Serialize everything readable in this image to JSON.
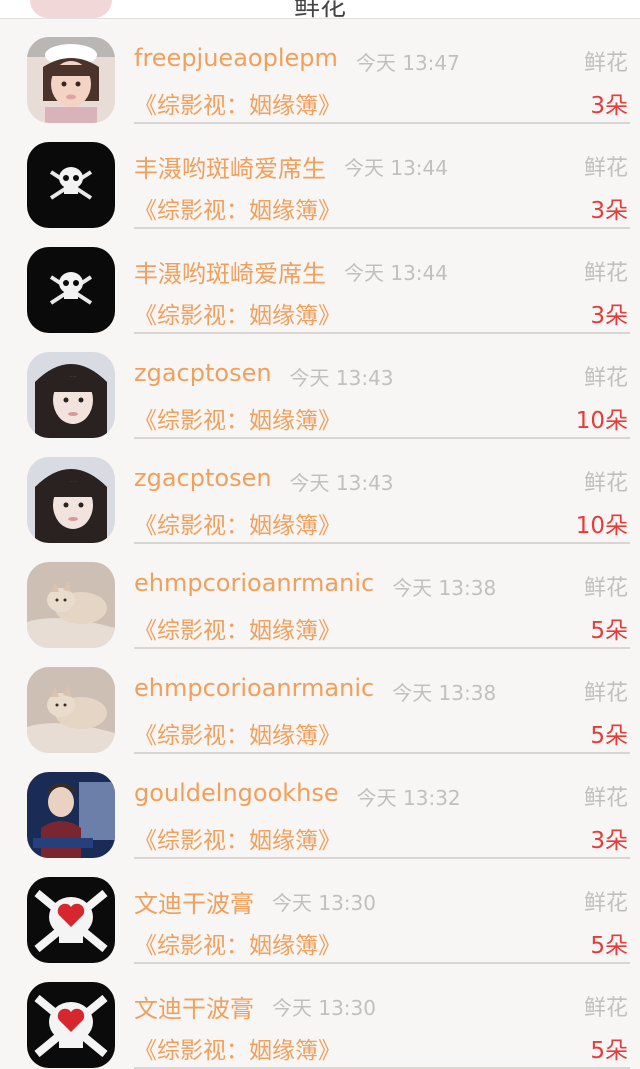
{
  "header": {
    "title": "鲜花"
  },
  "rows": [
    {
      "name": "freepjueaoplepm",
      "time": "今天 13:47",
      "gift_label": "鲜花",
      "book": "《综影视：姻缘簿》",
      "count": "3朵",
      "avatar": "girl-photo"
    },
    {
      "name": "丰滠哟斑崎爱席生",
      "time": "今天 13:44",
      "gift_label": "鲜花",
      "book": "《综影视：姻缘簿》",
      "count": "3朵",
      "avatar": "skull-emblem"
    },
    {
      "name": "丰滠哟斑崎爱席生",
      "time": "今天 13:44",
      "gift_label": "鲜花",
      "book": "《综影视：姻缘簿》",
      "count": "3朵",
      "avatar": "skull-emblem"
    },
    {
      "name": "zgacptosen",
      "time": "今天 13:43",
      "gift_label": "鲜花",
      "book": "《综影视：姻缘簿》",
      "count": "10朵",
      "avatar": "woman-photo"
    },
    {
      "name": "zgacptosen",
      "time": "今天 13:43",
      "gift_label": "鲜花",
      "book": "《综影视：姻缘簿》",
      "count": "10朵",
      "avatar": "woman-photo"
    },
    {
      "name": "ehmpcorioanrmanic",
      "time": "今天 13:38",
      "gift_label": "鲜花",
      "book": "《综影视：姻缘簿》",
      "count": "5朵",
      "avatar": "cat-photo"
    },
    {
      "name": "ehmpcorioanrmanic",
      "time": "今天 13:38",
      "gift_label": "鲜花",
      "book": "《综影视：姻缘簿》",
      "count": "5朵",
      "avatar": "cat-photo"
    },
    {
      "name": "gouldelngookhse",
      "time": "今天 13:32",
      "gift_label": "鲜花",
      "book": "《综影视：姻缘簿》",
      "count": "3朵",
      "avatar": "man-photo"
    },
    {
      "name": "文迪干波膏",
      "time": "今天 13:30",
      "gift_label": "鲜花",
      "book": "《综影视：姻缘簿》",
      "count": "5朵",
      "avatar": "heart-skull"
    },
    {
      "name": "文迪干波膏",
      "time": "今天 13:30",
      "gift_label": "鲜花",
      "book": "《综影视：姻缘簿》",
      "count": "5朵",
      "avatar": "heart-skull"
    }
  ],
  "colors": {
    "name": "#f0a05c",
    "count": "#e43b3b",
    "muted": "#c2bfbc",
    "background": "#f8f6f5"
  }
}
